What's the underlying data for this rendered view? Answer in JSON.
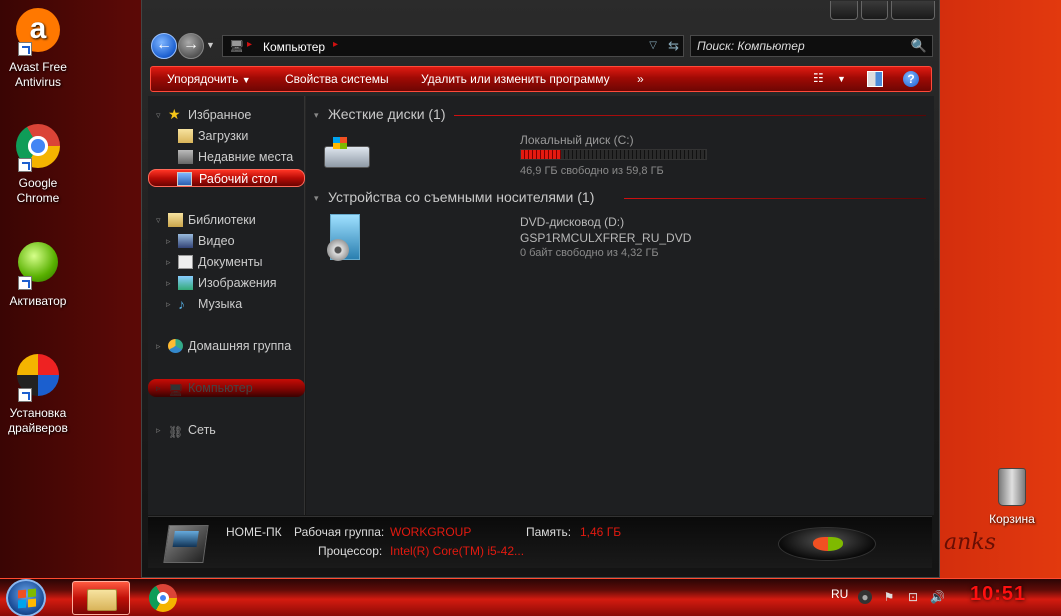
{
  "desktop": {
    "icons": [
      {
        "label": "Avast Free Antivirus",
        "icon": "avast-icon"
      },
      {
        "label": "Google Chrome",
        "icon": "chrome-icon"
      },
      {
        "label": "Активатор",
        "icon": "activator-icon"
      },
      {
        "label": "Установка драйверов",
        "icon": "driver-install-icon"
      }
    ],
    "recycle_bin": "Корзина",
    "signature": "anks"
  },
  "window": {
    "address": {
      "path_item": "Компьютер"
    },
    "search": {
      "placeholder": "Поиск: Компьютер"
    },
    "toolbar": {
      "organize": "Упорядочить",
      "system_properties": "Свойства системы",
      "uninstall": "Удалить или изменить программу",
      "more": "»"
    },
    "nav": {
      "favorites": "Избранное",
      "downloads": "Загрузки",
      "recent": "Недавние места",
      "desktop": "Рабочий стол",
      "libraries": "Библиотеки",
      "video": "Видео",
      "documents": "Документы",
      "images": "Изображения",
      "music": "Музыка",
      "homegroup": "Домашняя группа",
      "computer": "Компьютер",
      "network": "Сеть"
    },
    "content": {
      "hard_disks_header": "Жесткие диски (1)",
      "removable_header": "Устройства со съемными носителями (1)",
      "local_disk": {
        "name": "Локальный диск (C:)",
        "free": "46,9 ГБ свободно из 59,8 ГБ",
        "used_fraction": 0.216
      },
      "dvd": {
        "name": "DVD-дисковод (D:)",
        "label": "GSP1RMCULXFRER_RU_DVD",
        "free": "0 байт свободно из 4,32 ГБ"
      }
    },
    "details": {
      "pc_name": "HOME-ПК",
      "workgroup_label": "Рабочая группа:",
      "workgroup_value": "WORKGROUP",
      "memory_label": "Память:",
      "memory_value": "1,46 ГБ",
      "cpu_label": "Процессор:",
      "cpu_value": "Intel(R) Core(TM) i5-42..."
    }
  },
  "taskbar": {
    "language": "RU",
    "clock": "10:51"
  },
  "colors": {
    "accent": "#e21a10",
    "panel": "#1e1f21"
  }
}
